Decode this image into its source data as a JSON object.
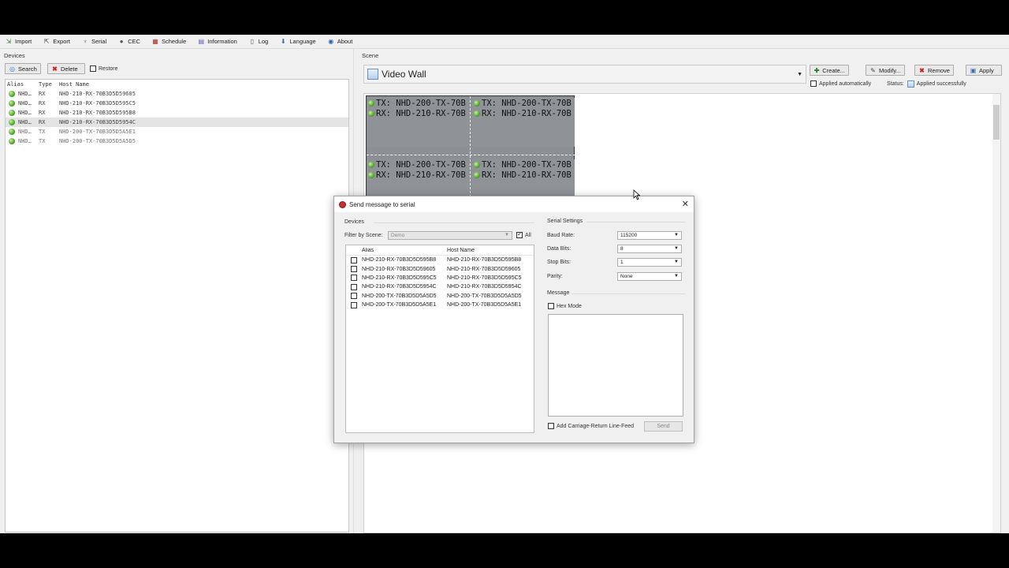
{
  "menubar": {
    "items": [
      {
        "label": "Import",
        "icon": "import-icon"
      },
      {
        "label": "Export",
        "icon": "export-icon"
      },
      {
        "label": "Serial",
        "icon": "serial-icon"
      },
      {
        "label": "CEC",
        "icon": "cec-icon"
      },
      {
        "label": "Schedule",
        "icon": "schedule-icon"
      },
      {
        "label": "Information",
        "icon": "information-icon"
      },
      {
        "label": "Log",
        "icon": "log-icon"
      },
      {
        "label": "Language",
        "icon": "language-icon"
      },
      {
        "label": "About",
        "icon": "about-icon"
      }
    ]
  },
  "devices": {
    "title": "Devices",
    "search_label": "Search",
    "delete_label": "Delete",
    "restore_label": "Restore",
    "columns": {
      "alias": "Alias",
      "type": "Type",
      "host": "Host Name"
    },
    "rows": [
      {
        "alias": "NHD…",
        "type": "RX",
        "host": "NHD-210-RX-70B3D5D59605"
      },
      {
        "alias": "NHD…",
        "type": "RX",
        "host": "NHD-210-RX-70B3D5D595C5"
      },
      {
        "alias": "NHD…",
        "type": "RX",
        "host": "NHD-210-RX-70B3D5D595B8"
      },
      {
        "alias": "NHD…",
        "type": "RX",
        "host": "NHD-210-RX-70B3D5D5954C"
      },
      {
        "alias": "NHD…",
        "type": "TX",
        "host": "NHD-200-TX-70B3D5D5A5E1"
      },
      {
        "alias": "NHD…",
        "type": "TX",
        "host": "NHD-200-TX-70B3D5D5A5D5"
      }
    ]
  },
  "scene": {
    "title": "Scene",
    "selected": "Video Wall",
    "create_label": "Create...",
    "modify_label": "Modify...",
    "remove_label": "Remove",
    "apply_label": "Apply",
    "applied_auto_label": "Applied automatically",
    "status_label": "Status:",
    "status_value": "Applied successfully",
    "tiles": [
      {
        "tx": "TX: NHD-200-TX-70B",
        "rx": "RX: NHD-210-RX-70B"
      },
      {
        "tx": "TX: NHD-200-TX-70B",
        "rx": "RX: NHD-210-RX-70B"
      },
      {
        "tx": "TX: NHD-200-TX-70B",
        "rx": "RX: NHD-210-RX-70B"
      },
      {
        "tx": "TX: NHD-200-TX-70B",
        "rx": "RX: NHD-210-RX-70B"
      }
    ]
  },
  "dialog": {
    "title": "Send message to serial",
    "devices_label": "Devices",
    "filter_label": "Filter by Scene:",
    "filter_value": "Demo",
    "all_label": "All",
    "columns": {
      "alias": "Alias",
      "host": "Host Name"
    },
    "rows": [
      {
        "alias": "NHD-210-RX-70B3D5D595B8",
        "host": "NHD-210-RX-70B3D5D595B8"
      },
      {
        "alias": "NHD-210-RX-70B3D5D59605",
        "host": "NHD-210-RX-70B3D5D59605"
      },
      {
        "alias": "NHD-210-RX-70B3D5D595C5",
        "host": "NHD-210-RX-70B3D5D595C5"
      },
      {
        "alias": "NHD-210-RX-70B3D5D5954C",
        "host": "NHD-210-RX-70B3D5D5954C"
      },
      {
        "alias": "NHD-200-TX-70B3D5D5A5D5",
        "host": "NHD-200-TX-70B3D5D5A5D5"
      },
      {
        "alias": "NHD-200-TX-70B3D5D5A5E1",
        "host": "NHD-200-TX-70B3D5D5A5E1"
      }
    ],
    "serial_settings_label": "Serial Settings",
    "baud_label": "Baud Rate:",
    "baud_value": "115200",
    "data_bits_label": "Data Bits:",
    "data_bits_value": "8",
    "stop_bits_label": "Stop Bits:",
    "stop_bits_value": "1",
    "parity_label": "Parity:",
    "parity_value": "None",
    "message_label": "Message",
    "hex_mode_label": "Hex Mode",
    "crlf_label": "Add Carriage-Return Line-Feed",
    "send_label": "Send"
  },
  "colors": {
    "status_green": "#3f9a1d",
    "wall_gray": "#8f9398",
    "dialog_icon_red": "#c9302c"
  }
}
